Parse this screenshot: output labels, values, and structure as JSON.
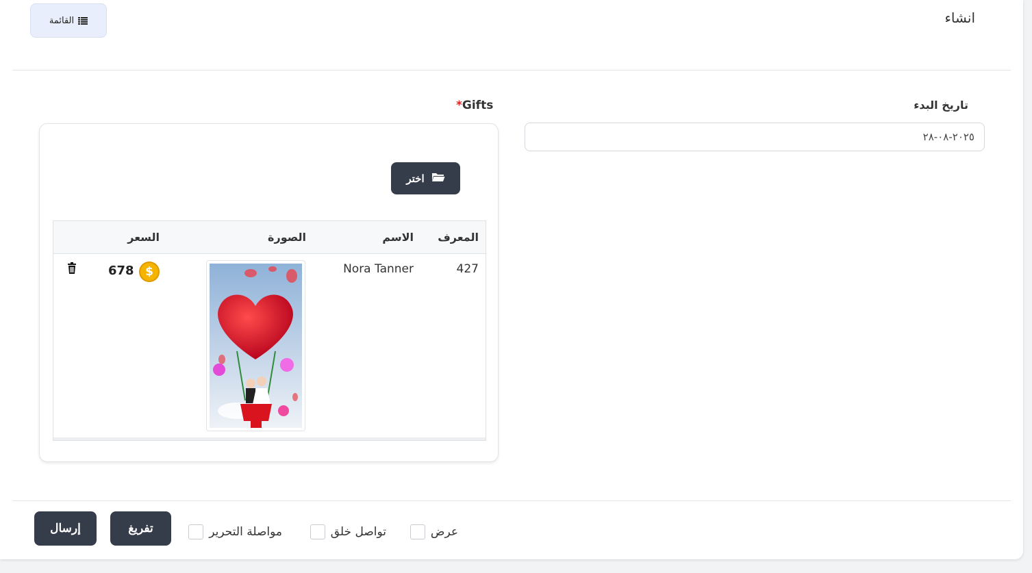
{
  "header": {
    "title": "انشاء",
    "list_button_label": "القائمة",
    "list_icon": "list-icon"
  },
  "form": {
    "start_date": {
      "label": "تاريخ البدء",
      "value": "٢٠٢٥-٠٨-٢٨"
    },
    "gifts": {
      "label": "Gifts",
      "required_mark": "*",
      "choose_button_label": "اختر",
      "choose_icon": "folder-open-icon",
      "table": {
        "headers": {
          "id": "المعرف",
          "name": "الاسم",
          "image": "الصورة",
          "price": "السعر"
        },
        "rows": [
          {
            "id": "427",
            "name": "Nora Tanner",
            "image_desc": "heart-balloon-couple-image",
            "price": "678",
            "coin_symbol": "$",
            "delete_icon": "trash-icon"
          }
        ]
      }
    }
  },
  "footer": {
    "options": [
      {
        "label": "عرض",
        "checked": false
      },
      {
        "label": "تواصل خلق",
        "checked": false
      },
      {
        "label": "مواصلة التحرير",
        "checked": false
      }
    ],
    "reset_button_label": "تفريغ",
    "submit_button_label": "إرسال"
  },
  "colors": {
    "dark_button": "#353c4a",
    "list_button_bg": "#e8eefb",
    "required": "#e02424",
    "coin": "#f5b400"
  }
}
